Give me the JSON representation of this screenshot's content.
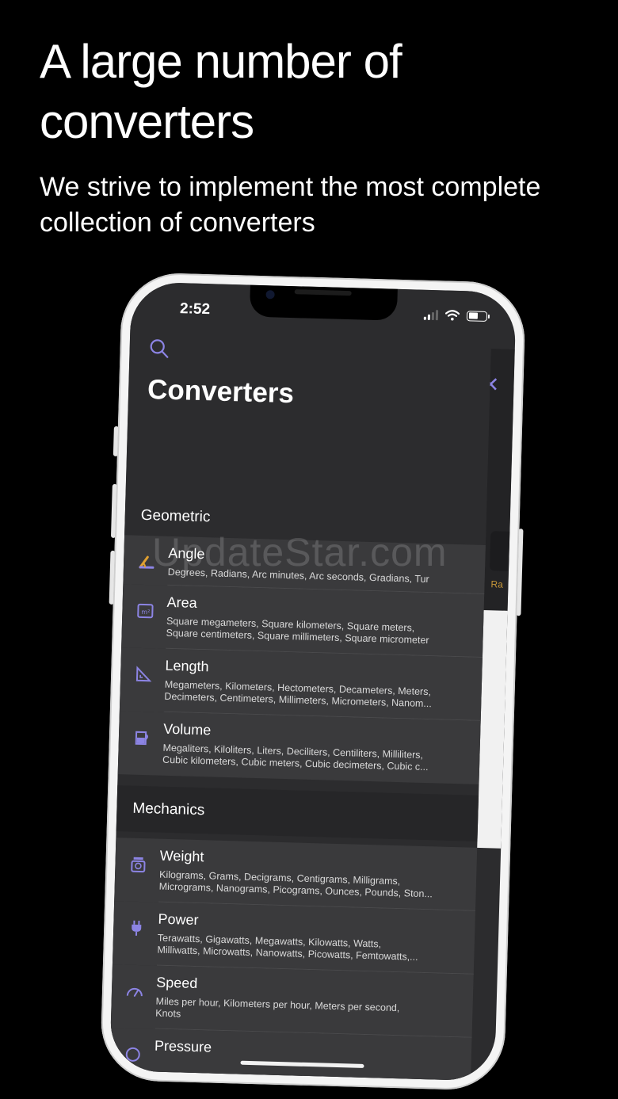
{
  "headline": "A large number of converters",
  "subhead": "We strive to implement the most complete collection of converters",
  "status": {
    "time": "2:52"
  },
  "screen": {
    "title": "Converters",
    "search_icon": "search-icon",
    "accent_color": "#8c84e4",
    "sections": [
      {
        "label": "Geometric",
        "items": [
          {
            "name": "Angle",
            "icon": "angle-icon",
            "desc1": "Degrees, Radians, Arc minutes, Arc seconds, Gradians, Tur",
            "desc2": ""
          },
          {
            "name": "Area",
            "icon": "area-icon",
            "desc1": "Square megameters, Square kilometers, Square meters,",
            "desc2": "Square centimeters, Square millimeters, Square micrometer"
          },
          {
            "name": "Length",
            "icon": "length-icon",
            "desc1": "Megameters, Kilometers, Hectometers, Decameters, Meters,",
            "desc2": "Decimeters, Centimeters, Millimeters, Micrometers, Nanom..."
          },
          {
            "name": "Volume",
            "icon": "volume-icon",
            "desc1": "Megaliters, Kiloliters, Liters, Deciliters, Centiliters, Milliliters,",
            "desc2": "Cubic kilometers, Cubic meters, Cubic decimeters, Cubic c..."
          }
        ]
      },
      {
        "label": "Mechanics",
        "items": [
          {
            "name": "Weight",
            "icon": "weight-icon",
            "desc1": "Kilograms, Grams, Decigrams, Centigrams, Milligrams,",
            "desc2": "Micrograms, Nanograms, Picograms, Ounces, Pounds, Ston..."
          },
          {
            "name": "Power",
            "icon": "power-icon",
            "desc1": "Terawatts, Gigawatts, Megawatts, Kilowatts, Watts,",
            "desc2": "Milliwatts, Microwatts, Nanowatts, Picowatts, Femtowatts,..."
          },
          {
            "name": "Speed",
            "icon": "speed-icon",
            "desc1": "Miles per hour, Kilometers per hour, Meters per second,",
            "desc2": "Knots"
          },
          {
            "name": "Pressure",
            "icon": "pressure-icon",
            "desc1": "",
            "desc2": ""
          }
        ]
      }
    ],
    "side_card": {
      "close_icon": "close-icon",
      "label": "Ra"
    }
  },
  "watermark": "UpdateStar.com"
}
